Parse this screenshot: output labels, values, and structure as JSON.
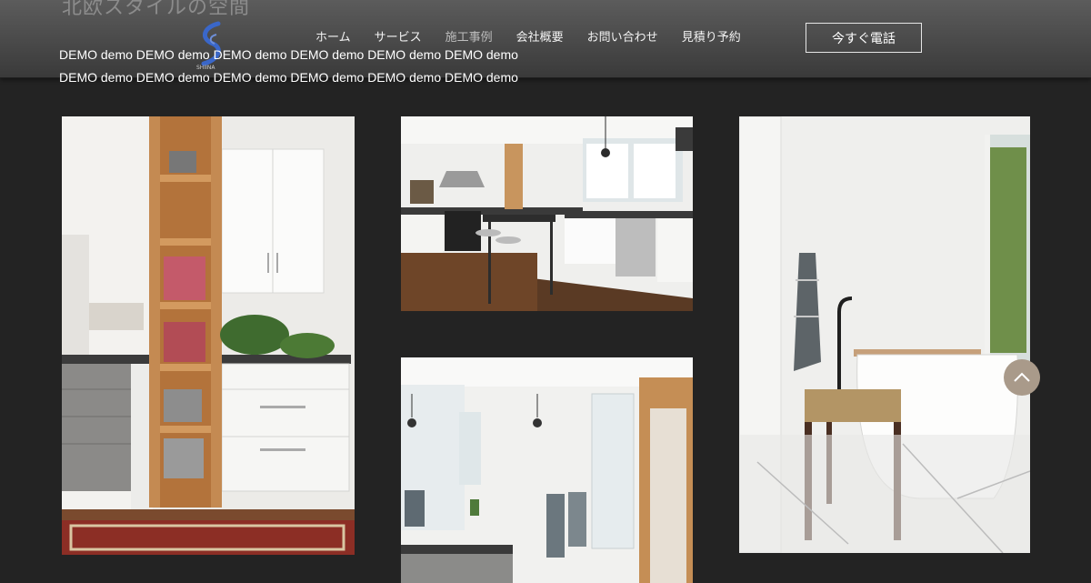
{
  "header": {
    "site_title": "北欧スタイルの空間",
    "logo_text": "SHIINA",
    "demo_line_1": "DEMO demo DEMO demo DEMO demo DEMO demo DEMO demo DEMO demo",
    "demo_line_2": "DEMO demo DEMO demo DEMO demo DEMO demo DEMO demo DEMO demo",
    "nav": [
      {
        "label": "ホーム"
      },
      {
        "label": "サービス"
      },
      {
        "label": "施工事例"
      },
      {
        "label": "会社概要"
      },
      {
        "label": "お問い合わせ"
      },
      {
        "label": "見積り予約"
      }
    ],
    "cta_label": "今すぐ電話"
  },
  "gallery": {
    "images": [
      {
        "name": "kitchen-shelf-photo"
      },
      {
        "name": "kitchen-island-photo"
      },
      {
        "name": "bathroom-vanity-photo"
      },
      {
        "name": "bathroom-tub-photo"
      }
    ]
  },
  "icons": {
    "scroll_top": "chevron-up-icon",
    "logo": "swirl-s-logo"
  },
  "colors": {
    "background": "#232323",
    "header": "#4a4a4a",
    "scroll_button": "#a99a8a",
    "text": "#ffffff"
  }
}
